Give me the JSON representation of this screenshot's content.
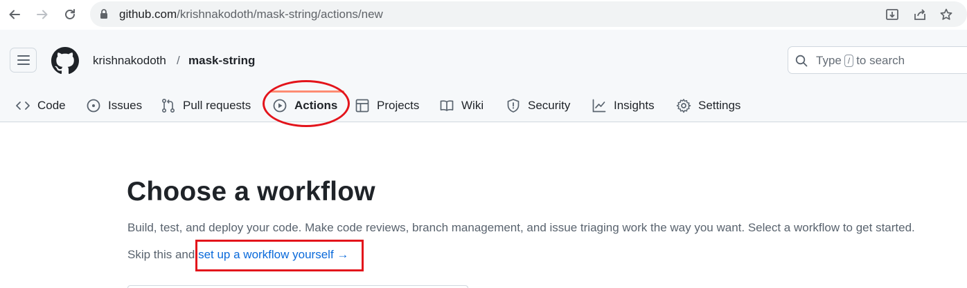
{
  "browser": {
    "url_host": "github.com",
    "url_path": "/krishnakodoth/mask-string/actions/new",
    "icons": [
      "back-arrow-icon",
      "forward-arrow-icon",
      "reload-icon",
      "lock-icon",
      "install-icon",
      "share-icon",
      "bookmark-star-icon"
    ]
  },
  "header": {
    "owner": "krishnakodoth",
    "separator": "/",
    "repo": "mask-string",
    "search": {
      "prefix": "Type",
      "key": "/",
      "suffix": "to search"
    }
  },
  "tabs": [
    {
      "label": "Code",
      "icon": "code-icon"
    },
    {
      "label": "Issues",
      "icon": "issue-circle-icon"
    },
    {
      "label": "Pull requests",
      "icon": "pull-request-icon"
    },
    {
      "label": "Actions",
      "icon": "play-circle-icon",
      "active": true
    },
    {
      "label": "Projects",
      "icon": "table-icon"
    },
    {
      "label": "Wiki",
      "icon": "book-icon"
    },
    {
      "label": "Security",
      "icon": "shield-icon"
    },
    {
      "label": "Insights",
      "icon": "graph-icon"
    },
    {
      "label": "Settings",
      "icon": "gear-icon"
    }
  ],
  "main": {
    "title": "Choose a workflow",
    "description": "Build, test, and deploy your code. Make code reviews, branch management, and issue triaging work the way you want. Select a workflow to get started.",
    "skip_prefix": "Skip this and",
    "skip_link": "set up a workflow yourself",
    "skip_arrow": "→"
  },
  "colors": {
    "link": "#0969da",
    "active_tab_underline": "#fd8c73",
    "annotation": "#e3141b"
  }
}
